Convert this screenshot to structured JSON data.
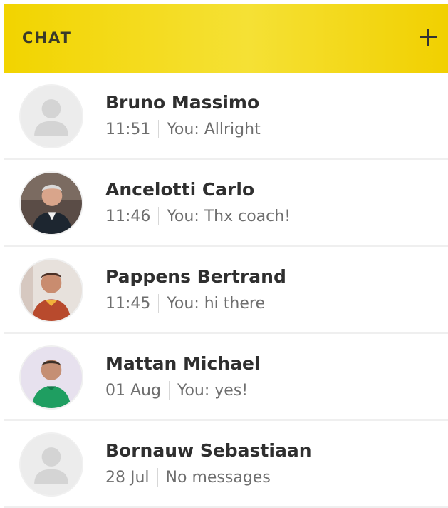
{
  "header": {
    "title": "CHAT",
    "add_icon": "plus-icon",
    "background_color": "#f2d400"
  },
  "conversations": [
    {
      "name": "Bruno Massimo",
      "time": "11:51",
      "last_message": "You: Allright",
      "avatar": "default-avatar"
    },
    {
      "name": "Ancelotti Carlo",
      "time": "11:46",
      "last_message": "You: Thx coach!",
      "avatar": "photo-avatar"
    },
    {
      "name": "Pappens Bertrand",
      "time": "11:45",
      "last_message": "You: hi there",
      "avatar": "photo-avatar"
    },
    {
      "name": "Mattan Michael",
      "time": "01 Aug",
      "last_message": "You: yes!",
      "avatar": "photo-avatar"
    },
    {
      "name": "Bornauw Sebastiaan",
      "time": "28 Jul",
      "last_message": "No messages",
      "avatar": "default-avatar"
    }
  ]
}
